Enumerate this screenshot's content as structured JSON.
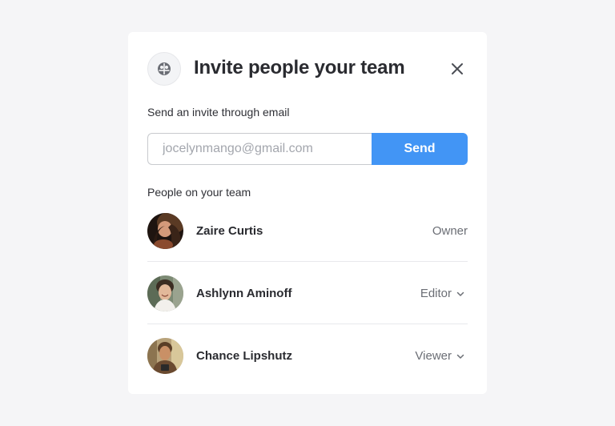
{
  "dialog": {
    "title": "Invite people your team",
    "team_icon": "team-icon",
    "close_icon": "close-icon"
  },
  "invite": {
    "label": "Send an invite through email",
    "email_placeholder": "jocelynmango@gmail.com",
    "send_label": "Send"
  },
  "team": {
    "label": "People on your team",
    "members": [
      {
        "name": "Zaire Curtis",
        "role": "Owner",
        "editable": false
      },
      {
        "name": "Ashlynn Aminoff",
        "role": "Editor",
        "editable": true
      },
      {
        "name": "Chance Lipshutz",
        "role": "Viewer",
        "editable": true
      }
    ]
  },
  "colors": {
    "accent": "#4295f5",
    "background": "#f5f5f7",
    "card": "#ffffff"
  }
}
